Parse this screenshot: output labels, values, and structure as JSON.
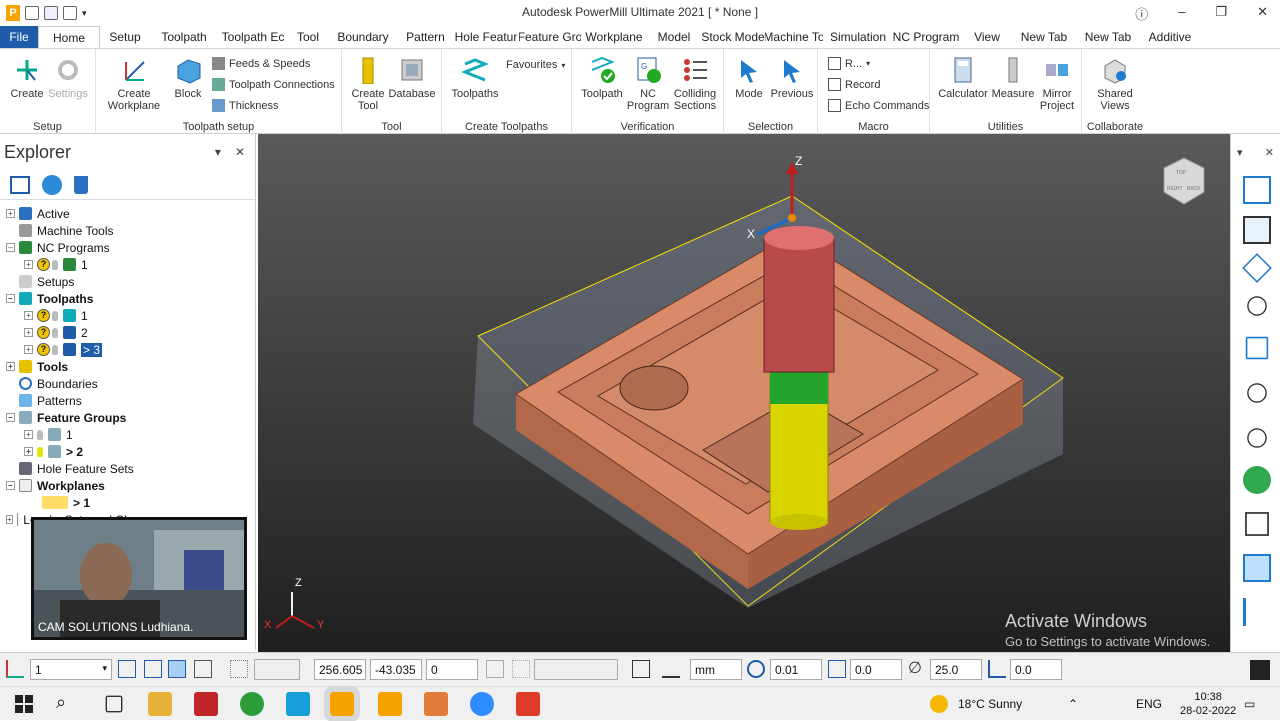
{
  "app": {
    "title": "Autodesk PowerMill Ultimate 2021    [ * None ]"
  },
  "tabs": [
    "File",
    "Home",
    "Setup",
    "Toolpath",
    "Toolpath Ec",
    "Tool",
    "Boundary",
    "Pattern",
    "Hole Featur",
    "Feature Gro",
    "Workplane",
    "Model",
    "Stock Mode",
    "Machine To",
    "Simulation",
    "NC Program",
    "View",
    "New Tab",
    "New Tab",
    "Additive"
  ],
  "ribbon": {
    "setup": {
      "label": "Setup",
      "create": "Create",
      "settings": "Settings"
    },
    "toolpath_setup": {
      "label": "Toolpath setup",
      "create_workplane": "Create Workplane",
      "block": "Block",
      "feeds": "Feeds & Speeds",
      "connections": "Toolpath Connections",
      "thickness": "Thickness"
    },
    "tool": {
      "label": "Tool",
      "create_tool": "Create Tool",
      "database": "Database"
    },
    "create_toolpaths": {
      "label": "Create Toolpaths",
      "toolpaths": "Toolpaths",
      "favourites": "Favourites"
    },
    "verification": {
      "label": "Verification",
      "toolpath": "Toolpath",
      "nc_program": "NC Program",
      "colliding": "Colliding Sections"
    },
    "selection": {
      "label": "Selection",
      "mode": "Mode",
      "previous": "Previous"
    },
    "macro": {
      "label": "Macro",
      "run": "R...",
      "record": "Record",
      "echo": "Echo Commands"
    },
    "utilities": {
      "label": "Utilities",
      "calculator": "Calculator",
      "measure": "Measure",
      "mirror": "Mirror Project"
    },
    "collaborate": {
      "label": "Collaborate",
      "shared": "Shared Views"
    }
  },
  "explorer": {
    "title": "Explorer",
    "tree": {
      "active": "Active",
      "machine_tools": "Machine Tools",
      "nc_programs": "NC Programs",
      "nc1": "1",
      "setups": "Setups",
      "toolpaths": "Toolpaths",
      "tp1": "1",
      "tp2": "2",
      "tp3": "> 3",
      "tools": "Tools",
      "boundaries": "Boundaries",
      "patterns": "Patterns",
      "feature_groups": "Feature Groups",
      "fg1": "1",
      "fg2": "> 2",
      "hole_feature_sets": "Hole Feature Sets",
      "workplanes": "Workplanes",
      "wp1": "> 1",
      "levels": "Levels, Sets and Clamps"
    }
  },
  "webcam": {
    "label": "CAM SOLUTIONS Ludhiana."
  },
  "viewport": {
    "axis_z": "Z",
    "axis_x": "X",
    "tri_z": "Z",
    "tri_y": "Y",
    "tri_x": "X",
    "cube_top": "TOP",
    "cube_right": "RIGHT",
    "cube_back": "BACK"
  },
  "watermark": {
    "line1": "Activate Windows",
    "line2": "Go to Settings to activate Windows."
  },
  "status": {
    "workplane": "1",
    "x": "256.605",
    "y": "-43.035",
    "z": "0",
    "units": "mm",
    "tol": "0.01",
    "v1": "0.0",
    "dia": "25.0",
    "v2": "0.0"
  },
  "taskbar": {
    "weather": "18°C  Sunny",
    "lang": "ENG",
    "time": "10:38",
    "date": "28-02-2022"
  }
}
